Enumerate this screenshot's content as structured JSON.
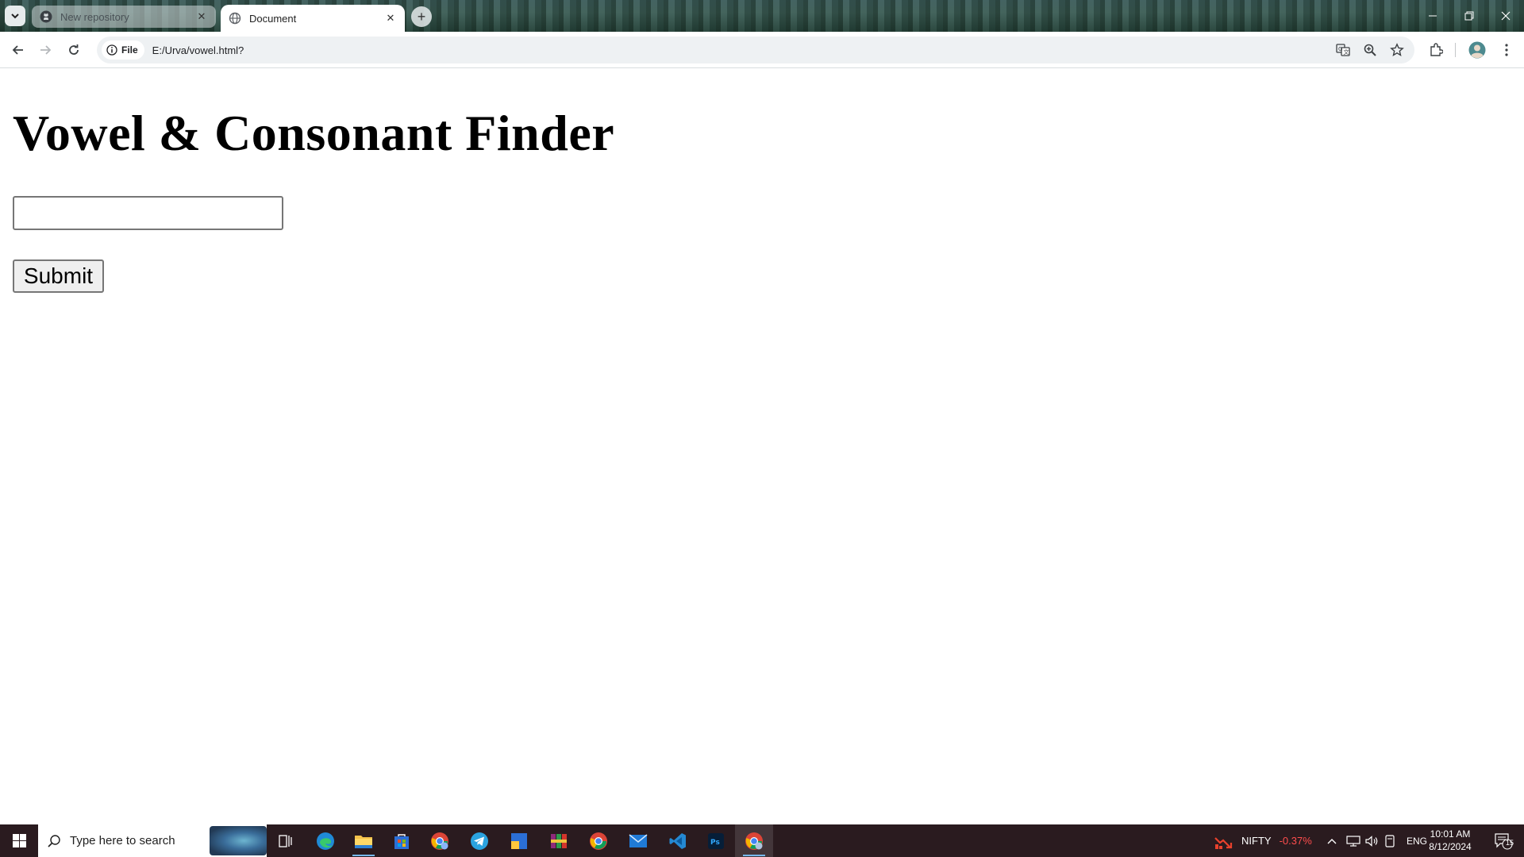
{
  "browser": {
    "tabs": [
      {
        "title": "New repository",
        "favicon": "github-icon",
        "active": false
      },
      {
        "title": "Document",
        "favicon": "globe-icon",
        "active": true
      }
    ],
    "address": {
      "chip_label": "File",
      "url": "E:/Urva/vowel.html?"
    }
  },
  "page": {
    "heading": "Vowel & Consonant Finder",
    "input_value": "",
    "submit_label": "Submit"
  },
  "taskbar": {
    "search_placeholder": "Type here to search",
    "apps": [
      "task-view-icon",
      "edge-icon",
      "file-explorer-icon",
      "store-icon",
      "chrome-profile-icon",
      "telegram-icon",
      "app-icon",
      "winrar-icon",
      "chrome-icon",
      "mail-icon",
      "vscode-icon",
      "photoshop-icon",
      "chrome-active-icon"
    ],
    "ticker_name": "NIFTY",
    "ticker_change": "-0.37%",
    "ticker_color": "#ff4d4d",
    "language": "ENG",
    "time": "10:01 AM",
    "date": "8/12/2024",
    "notification_count": "15"
  }
}
